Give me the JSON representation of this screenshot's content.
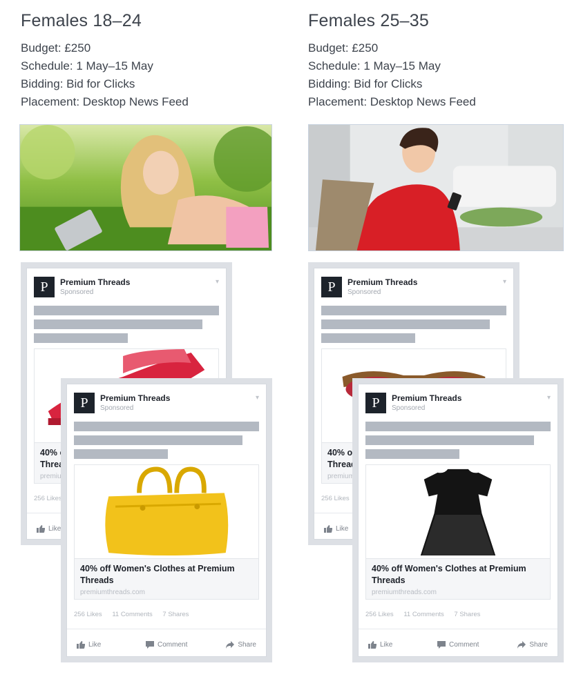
{
  "left": {
    "title": "Females 18–24",
    "budget": "Budget: £250",
    "schedule": "Schedule: 1 May–15 May",
    "bidding": "Bidding: Bid for Clicks",
    "placement": "Placement: Desktop News Feed",
    "back_ad": {
      "brand": "Premium Threads",
      "sponsored": "Sponsored",
      "logo": "P",
      "headline": "40% off Women's Clothes at Premium Threads",
      "url": "premiumthreads.com",
      "likes": "256 Likes",
      "like": "Like",
      "product_icon": "red-shoe-icon"
    },
    "front_ad": {
      "brand": "Premium Threads",
      "sponsored": "Sponsored",
      "logo": "P",
      "headline": "40% off Women's Clothes at Premium Threads",
      "url": "premiumthreads.com",
      "likes": "256 Likes",
      "comments": "11 Comments",
      "shares": "7 Shares",
      "like": "Like",
      "comment": "Comment",
      "share": "Share",
      "product_icon": "yellow-handbag-icon"
    }
  },
  "right": {
    "title": "Females 25–35",
    "budget": "Budget: £250",
    "schedule": "Schedule: 1 May–15 May",
    "bidding": "Bidding: Bid for Clicks",
    "placement": "Placement: Desktop News Feed",
    "back_ad": {
      "brand": "Premium Threads",
      "sponsored": "Sponsored",
      "logo": "P",
      "headline": "40% off Women's Clothes at Premium Threads",
      "url": "premiumthreads.com",
      "likes": "256 Likes",
      "like": "Like",
      "product_icon": "sunglasses-icon"
    },
    "front_ad": {
      "brand": "Premium Threads",
      "sponsored": "Sponsored",
      "logo": "P",
      "headline": "40% off Women's Clothes at Premium Threads",
      "url": "premiumthreads.com",
      "likes": "256 Likes",
      "comments": "11 Comments",
      "shares": "7 Shares",
      "like": "Like",
      "comment": "Comment",
      "share": "Share",
      "product_icon": "black-dress-icon"
    }
  },
  "colors": {
    "placeholder_bar": "#b3b9c2",
    "card_frame": "#dde0e5",
    "logo_bg": "#1d232b"
  }
}
